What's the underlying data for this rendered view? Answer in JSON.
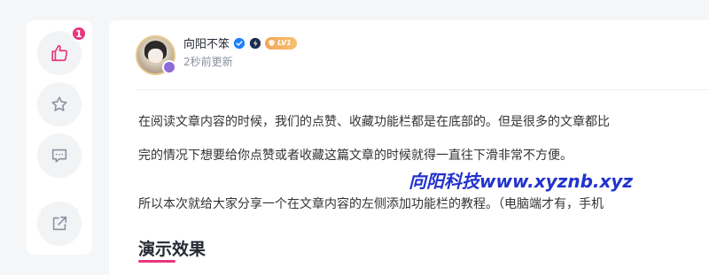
{
  "sidebar": {
    "like_count": "1"
  },
  "author": {
    "name": "向阳不笨",
    "updated": "2秒前更新",
    "level": "LV1"
  },
  "article": {
    "paragraphs": [
      "在阅读文章内容的时候，我们的点赞、收藏功能栏都是在底部的。但是很多的文章都比",
      "完的情况下想要给你点赞或者收藏这篇文章的时候就得一直往下滑非常不方便。",
      "所以本次就给大家分享一个在文章内容的左侧添加功能栏的教程。（电脑端才有，手机"
    ],
    "watermark": "向阳科技www.xyznb.xyz",
    "section_title": "演示效果"
  },
  "colors": {
    "accent": "#e8367f",
    "watermark": "#2233cc"
  }
}
